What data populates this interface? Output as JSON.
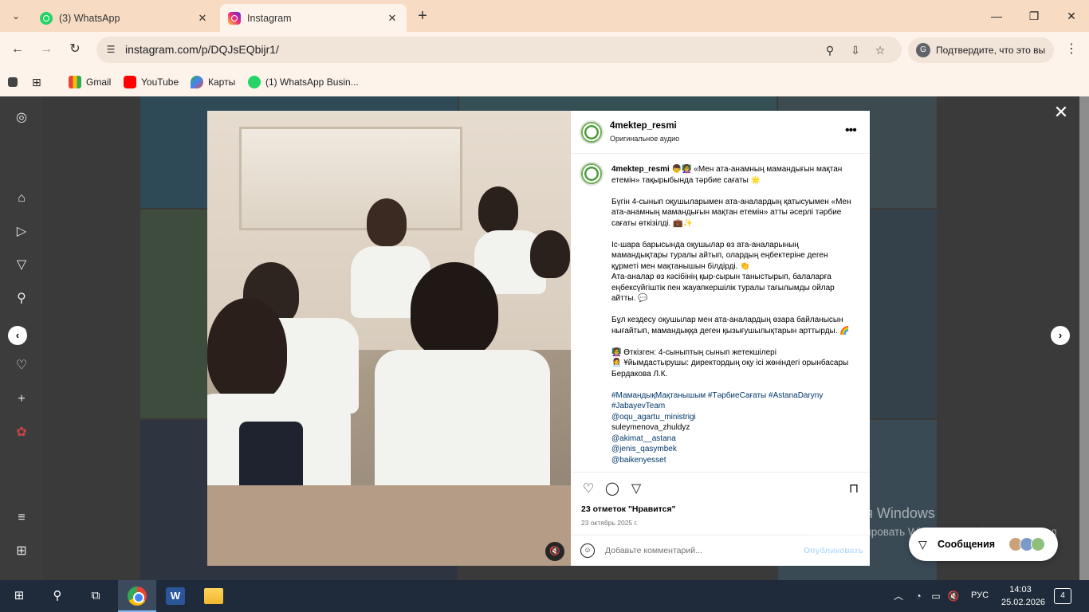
{
  "browser": {
    "tabs": [
      {
        "title": "(3) WhatsApp",
        "active": false,
        "icon": "whatsapp-icon"
      },
      {
        "title": "Instagram",
        "active": true,
        "icon": "instagram-icon"
      }
    ],
    "url": "instagram.com/p/DQJsEQbijr1/",
    "confirm_chip": "Подтвердите, что это вы",
    "bookmarks": [
      {
        "label": "Gmail",
        "icon": "gmail-icon"
      },
      {
        "label": "YouTube",
        "icon": "youtube-icon"
      },
      {
        "label": "Карты",
        "icon": "maps-icon"
      },
      {
        "label": "(1) WhatsApp Busin...",
        "icon": "whatsapp-icon"
      }
    ]
  },
  "post": {
    "username": "4mektep_resmi",
    "audio": "Оригинальное аудио",
    "caption_head": "👦👩‍🏫 «Мен ата-анамның мамандығын мақтан етемін» тақырыбында тәрбие сағаты 🌟",
    "paragraphs": [
      "Бүгін 4-сынып оқушыларымен ата-аналардың қатысуымен «Мен ата-анамның мамандығын мақтан етемін» атты әсерлі тәрбие сағаты өткізілді. 💼✨",
      "Іс-шара барысында оқушылар өз ата-аналарының мамандықтары туралы айтып, олардың еңбектеріне деген құрметі мен мақтанышын білдірді. 👏",
      "Ата-аналар өз кәсібінің қыр-сырын таныстырып, балаларға еңбексүйгіштік пен жауапкершілік туралы тағылымды ойлар айтты. 💬",
      "Бұл кездесу оқушылар мен ата-аналардың өзара байланысын нығайтып, мамандыққа деген қызығушылықтарын арттырды. 🌈",
      "👩‍🏫 Өткізген: 4-сыныптың сынып жетекшілері",
      "👩‍💼 Ұйымдастырушы: директордың оқу ісі жөніндегі орынбасары Бердакова Л.К."
    ],
    "hashtags": "#МамандықМақтанышым #ТәрбиеСағаты #AstanaDaryny #JabayevTeam",
    "mentions": [
      {
        "text": "@oqu_agartu_ministrigi",
        "link": true
      },
      {
        "text": "suleymenova_zhuldyz",
        "link": false
      },
      {
        "text": "@akimat__astana",
        "link": true
      },
      {
        "text": "@jenis_qasymbek",
        "link": true
      },
      {
        "text": "@baikenyesset",
        "link": true
      }
    ],
    "likes": "23 отметок \"Нравится\"",
    "date": "23 октябрь 2025 г.",
    "comment_placeholder": "Добавьте комментарий...",
    "publish_label": "Опубликовать"
  },
  "windows": {
    "activate_title": "Активация Windows",
    "activate_text": "Чтобы активировать Windows, перейдите в раздел \"Параметры\"."
  },
  "messages": {
    "label": "Сообщения"
  },
  "taskbar": {
    "lang": "РУС",
    "time": "14:03",
    "date": "25.02.2026",
    "notifications": "4"
  }
}
